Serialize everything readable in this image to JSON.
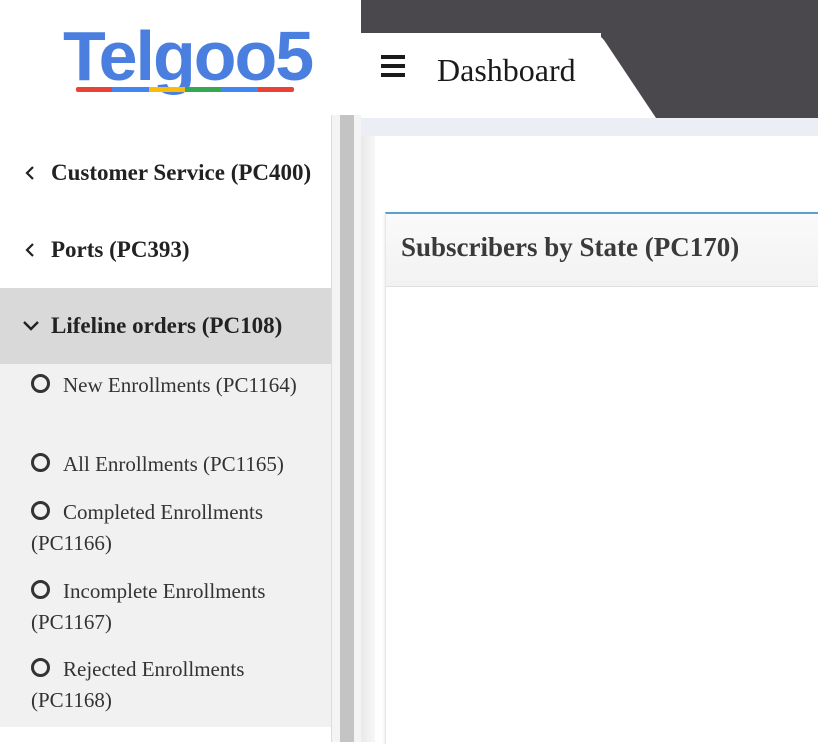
{
  "logo": {
    "text": "Telgoo5",
    "bar_colors": [
      "#ea4335",
      "#4285f4",
      "#fbbc05",
      "#34a853",
      "#4285f4",
      "#ea4335"
    ]
  },
  "header": {
    "title": "Dashboard",
    "menu_icon": "hamburger-menu-icon"
  },
  "sidebar": {
    "items": [
      {
        "label": "Customer Service (PC400)",
        "icon": "chevron-left-icon"
      },
      {
        "label": "Ports (PC393)",
        "icon": "chevron-left-icon"
      },
      {
        "label": "Lifeline orders (PC108)",
        "icon": "chevron-down-icon",
        "expanded": true
      }
    ],
    "subitems": [
      {
        "label": "New Enrollments (PC1164)"
      },
      {
        "label": "All Enrollments (PC1165)"
      },
      {
        "label": "Completed Enrollments (PC1166)"
      },
      {
        "label": "Incomplete Enrollments (PC1167)"
      },
      {
        "label": "Rejected Enrollments (PC1168)"
      }
    ]
  },
  "main": {
    "card_title": "Subscribers by State (PC170)"
  },
  "colors": {
    "topbar": "#4a474d",
    "card_accent": "#5ea0cc",
    "active_item_bg": "#d9d9d9"
  }
}
